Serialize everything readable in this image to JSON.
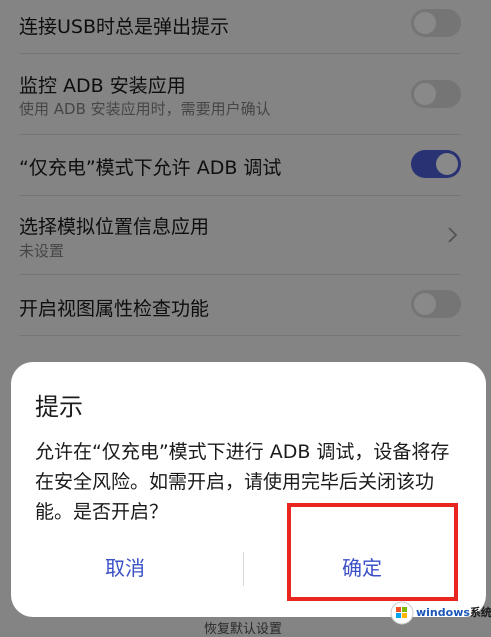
{
  "settings": {
    "usb_prompt": {
      "title": "连接USB时总是弹出提示",
      "toggle": "off"
    },
    "adb_monitor": {
      "title": "监控 ADB 安装应用",
      "subtitle": "使用 ADB 安装应用时，需要用户确认",
      "toggle": "off"
    },
    "charge_only_adb": {
      "title": "“仅充电”模式下允许 ADB 调试",
      "toggle": "on"
    },
    "mock_location": {
      "title": "选择模拟位置信息应用",
      "subtitle": "未设置"
    },
    "view_attr": {
      "title": "开启视图属性检查功能",
      "toggle": "off"
    }
  },
  "dialog": {
    "title": "提示",
    "message": "允许在“仅充电”模式下进行 ADB 调试，设备将存在安全风险。如需开启，请使用完毕后关闭该功能。是否开启？",
    "cancel_label": "取消",
    "confirm_label": "确定"
  },
  "bottom": {
    "restore_default": "恢复默认设置"
  },
  "watermark": {
    "brand": "windows",
    "brand_cn": "系统家园"
  },
  "colors": {
    "accent": "#4b5ccf",
    "highlight": "#e8261f",
    "button_text": "#3b4fc7"
  }
}
